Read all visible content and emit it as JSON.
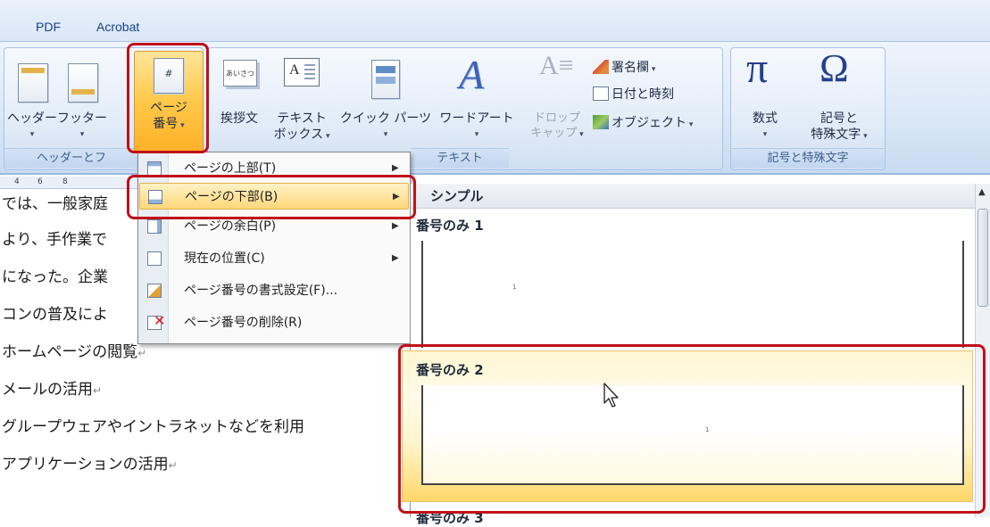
{
  "tabs": [
    "PDF",
    "Acrobat"
  ],
  "ribbon": {
    "header_footer_group": {
      "buttons": [
        {
          "label": "ヘッダー"
        },
        {
          "label": "フッター"
        },
        {
          "label_line1": "ページ",
          "label_line2": "番号"
        }
      ],
      "group_label": "ヘッダーとフ"
    },
    "text_group": {
      "buttons": [
        {
          "label": "挨拶文",
          "icon_text": "あいさつ"
        },
        {
          "label_line1": "テキスト",
          "label_line2": "ボックス",
          "icon_text": "A"
        },
        {
          "label": "クイック パーツ"
        },
        {
          "label": "ワードアート"
        },
        {
          "label_line1": "ドロップ",
          "label_line2": "キャップ"
        }
      ],
      "small_buttons": [
        "署名欄",
        "日付と時刻",
        "オブジェクト"
      ],
      "group_label": "テキスト"
    },
    "symbol_group": {
      "buttons": [
        {
          "label": "数式",
          "icon_text": "π"
        },
        {
          "label_line1": "記号と",
          "label_line2": "特殊文字",
          "icon_text": "Ω"
        }
      ],
      "group_label": "記号と特殊文字"
    }
  },
  "ruler": {
    "ticks": [
      "4",
      "6",
      "8"
    ]
  },
  "document": {
    "lines": [
      "では、一般家庭",
      "より、手作業で",
      "になった。企業",
      "コンの普及によ",
      "ホームページの閲覧",
      "メールの活用",
      "グループウェアやイントラネットなどを利用",
      "アプリケーションの活用"
    ],
    "para_mark": "↵"
  },
  "menu": {
    "items": [
      {
        "label": "ページの上部(T)",
        "submenu": true
      },
      {
        "label": "ページの下部(B)",
        "submenu": true,
        "active": true
      },
      {
        "label": "ページの余白(P)",
        "submenu": true
      },
      {
        "label": "現在の位置(C)",
        "submenu": true
      },
      {
        "label": "ページ番号の書式設定(F)...",
        "submenu": false
      },
      {
        "label": "ページ番号の削除(R)",
        "submenu": false
      }
    ]
  },
  "gallery": {
    "category": "シンプル",
    "items": [
      {
        "caption": "番号のみ 1",
        "page_number": "1"
      },
      {
        "caption": "番号のみ 2",
        "page_number": "1",
        "hovered": true
      },
      {
        "caption": "番号のみ 3"
      }
    ]
  },
  "colors": {
    "callout": "#c0101a",
    "hover": "#ffd77a",
    "ribbon": "#dbe8f7"
  },
  "icons": {
    "submenu_arrow": "triangle-right-icon",
    "delete": "red-x-icon"
  }
}
